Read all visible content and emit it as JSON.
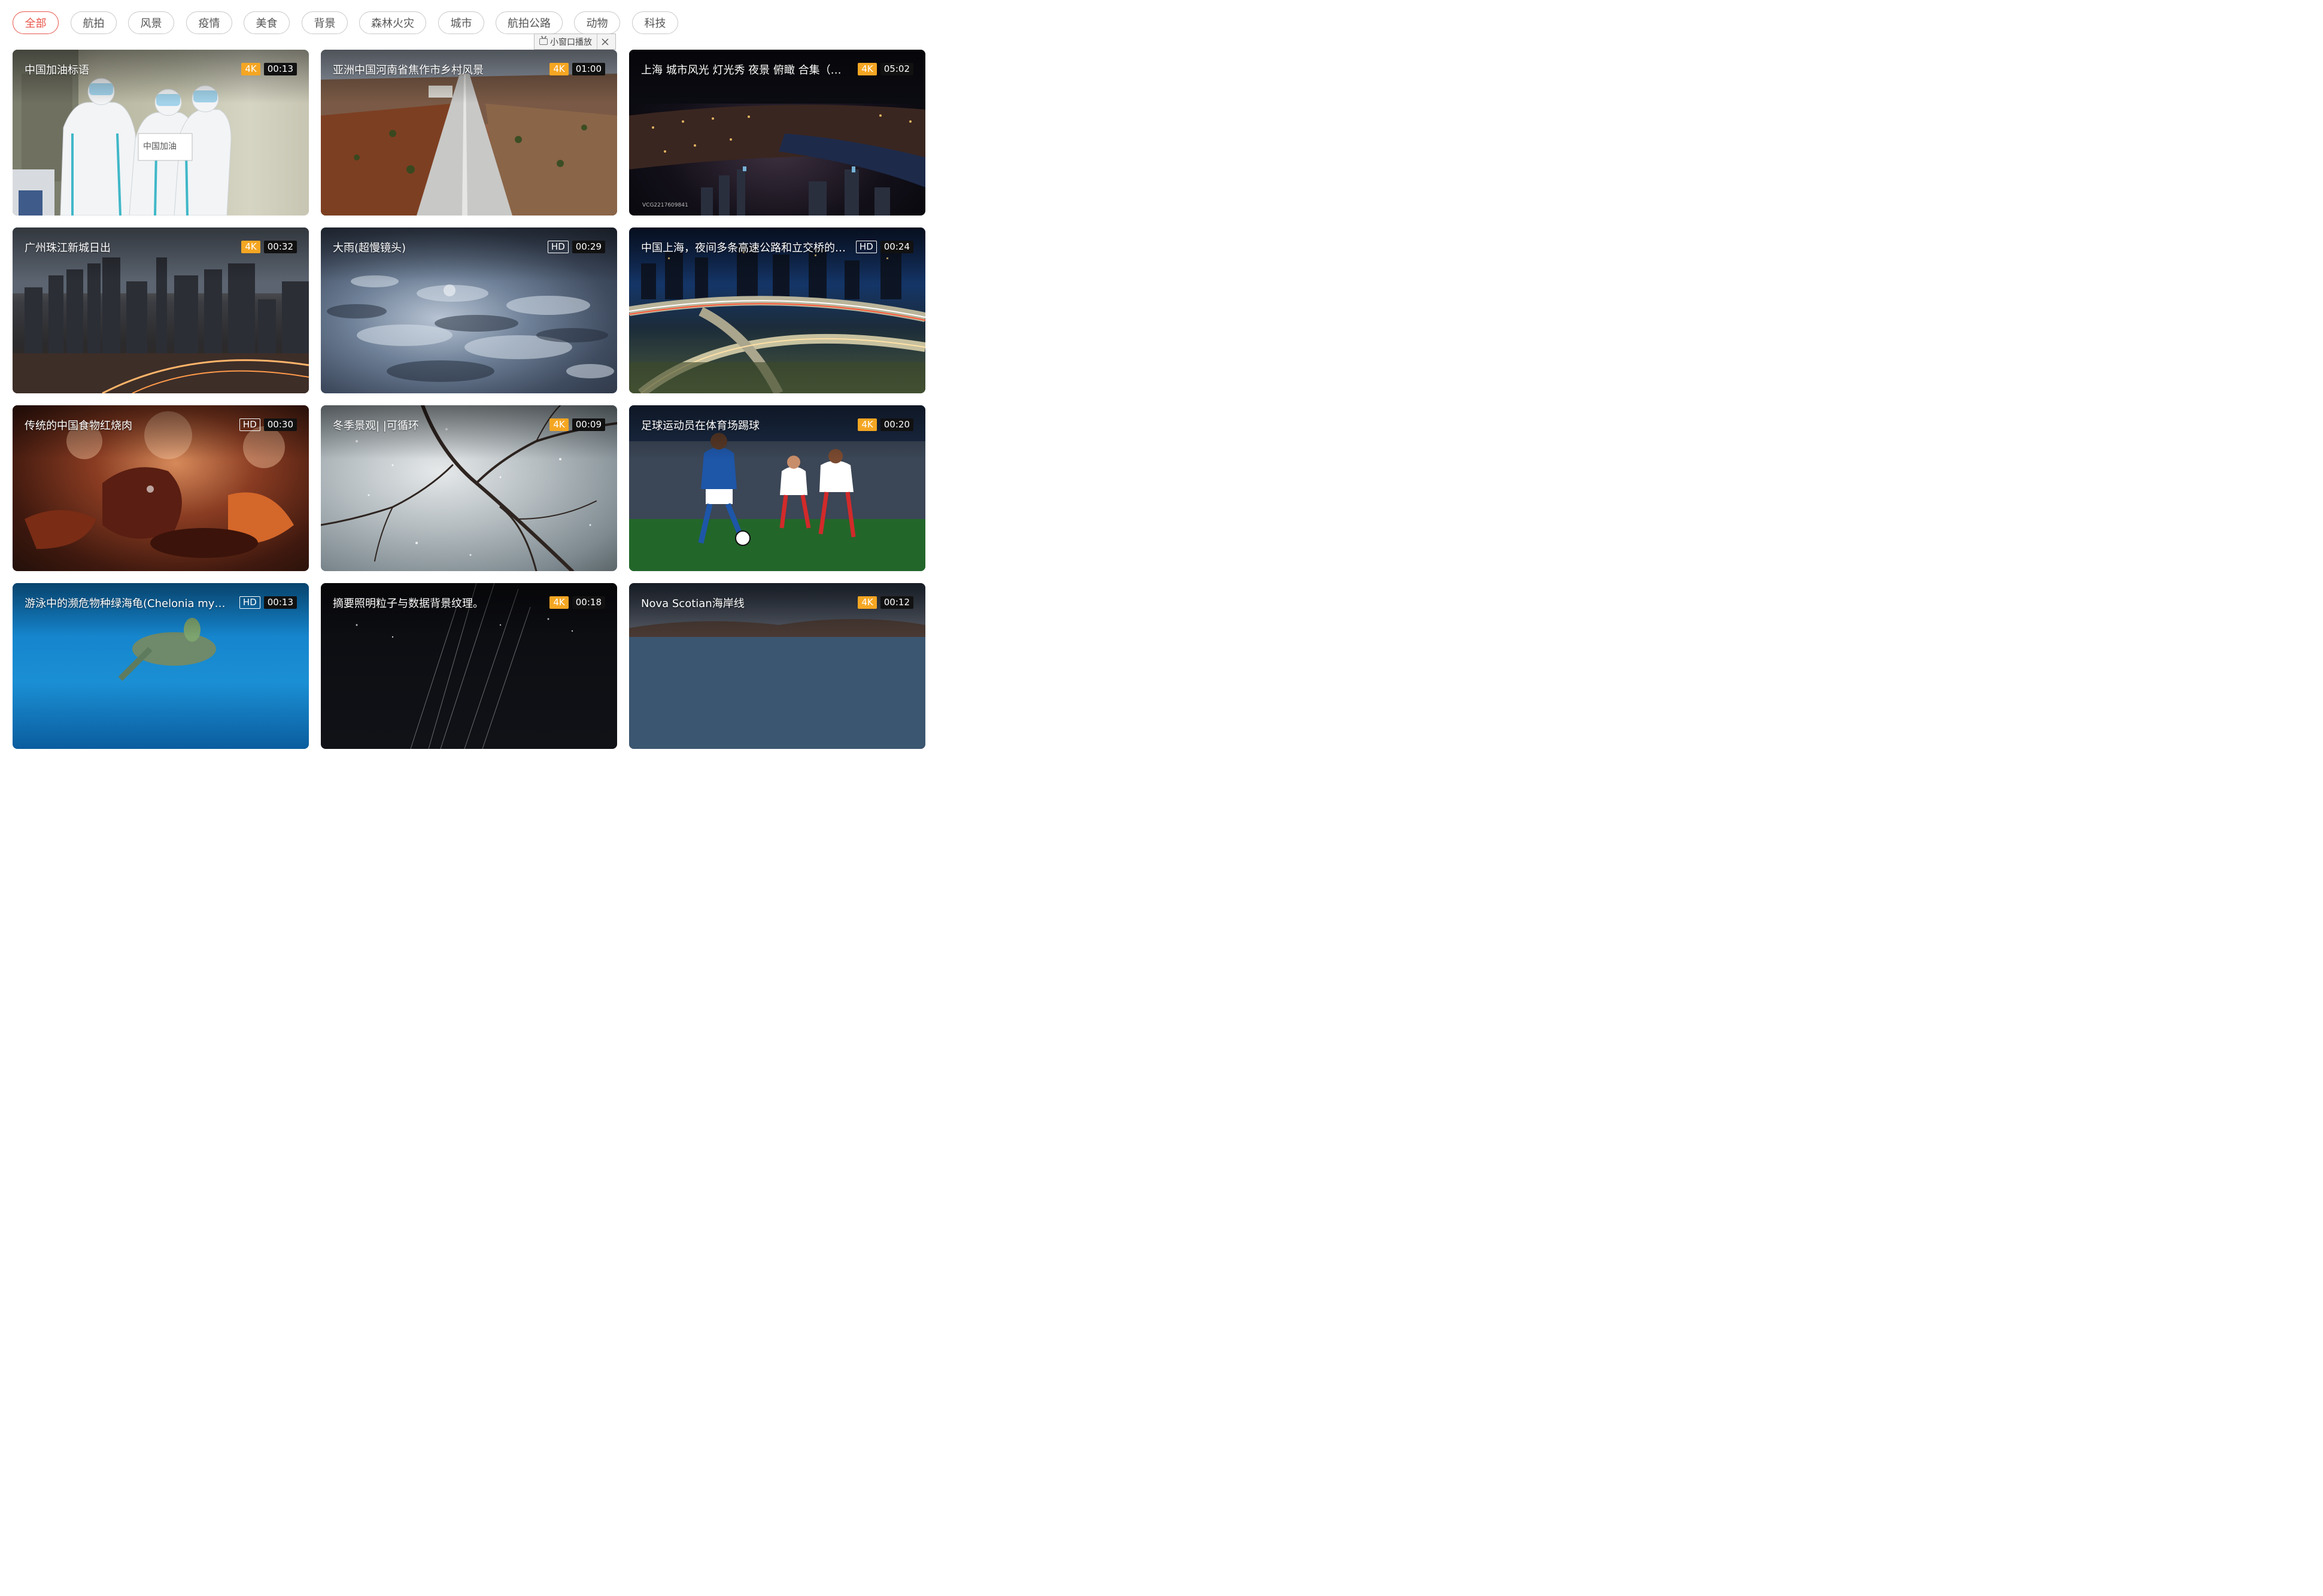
{
  "filters": {
    "active_index": 0,
    "items": [
      "全部",
      "航拍",
      "风景",
      "疫情",
      "美食",
      "背景",
      "森林火灾",
      "城市",
      "航拍公路",
      "动物",
      "科技"
    ]
  },
  "mini_window": {
    "label": "小窗口播放",
    "icon": "tv-icon",
    "close_icon": "close-icon"
  },
  "colors": {
    "accent": "#e8564a",
    "badge_4k": "#f5a623",
    "duration_bg": "#111111"
  },
  "videos": [
    {
      "title": "中国加油标语",
      "quality": "4K",
      "duration": "00:13",
      "sign_text": "中国加油"
    },
    {
      "title": "亚洲中国河南省焦作市乡村风景",
      "quality": "4K",
      "duration": "01:00"
    },
    {
      "title": "上海 城市风光 灯光秀 夜景 俯瞰 合集（选编）",
      "quality": "4K",
      "duration": "05:02",
      "watermark": "VCG2217609841"
    },
    {
      "title": "广州珠江新城日出",
      "quality": "4K",
      "duration": "00:32"
    },
    {
      "title": "大雨(超慢镜头)",
      "quality": "HD",
      "duration": "00:29"
    },
    {
      "title": "中国上海，夜间多条高速公路和立交桥的高...",
      "quality": "HD",
      "duration": "00:24"
    },
    {
      "title": "传统的中国食物红烧肉",
      "quality": "HD",
      "duration": "00:30"
    },
    {
      "title": "冬季景观| |可循环",
      "quality": "4K",
      "duration": "00:09"
    },
    {
      "title": "足球运动员在体育场踢球",
      "quality": "4K",
      "duration": "00:20"
    },
    {
      "title": "游泳中的濒危物种绿海龟(Chelonia mydas)。",
      "quality": "HD",
      "duration": "00:13"
    },
    {
      "title": "摘要照明粒子与数据背景纹理。",
      "quality": "4K",
      "duration": "00:18"
    },
    {
      "title": "Nova Scotian海岸线",
      "quality": "4K",
      "duration": "00:12"
    }
  ]
}
